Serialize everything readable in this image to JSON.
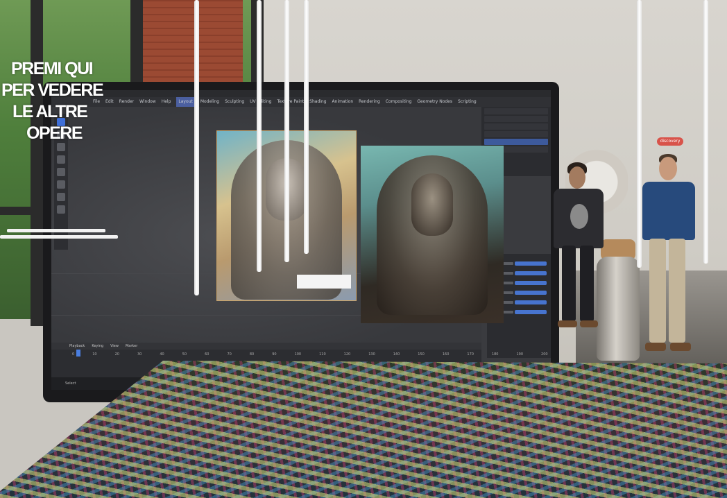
{
  "ar_overlay": {
    "menu_lines": [
      "PREMI QUI",
      "PER VEDERE",
      "LE ALTRE",
      "OPERE"
    ]
  },
  "blender": {
    "menu_items": [
      "File",
      "Edit",
      "Render",
      "Window",
      "Help",
      "Layout",
      "Modeling",
      "Sculpting",
      "UV Editing",
      "Texture Paint",
      "Shading",
      "Animation",
      "Rendering",
      "Compositing",
      "Geometry Nodes",
      "Scripting"
    ],
    "active_workspace": "Layout",
    "timeline_labels": [
      "Playback",
      "Keying",
      "View",
      "Marker"
    ],
    "timeline_ticks": [
      "0",
      "10",
      "20",
      "30",
      "40",
      "50",
      "60",
      "70",
      "80",
      "90",
      "100",
      "110",
      "120",
      "130",
      "140",
      "150",
      "160",
      "170",
      "180",
      "190",
      "200",
      "210",
      "220",
      "230",
      "240",
      "250"
    ],
    "status_text": "Select"
  },
  "scene": {
    "user_tag": "discovery"
  },
  "colors": {
    "accent_blue": "#3f6fd8",
    "user_tag_red": "#d8534a",
    "overlay_text": "#ffffff"
  }
}
